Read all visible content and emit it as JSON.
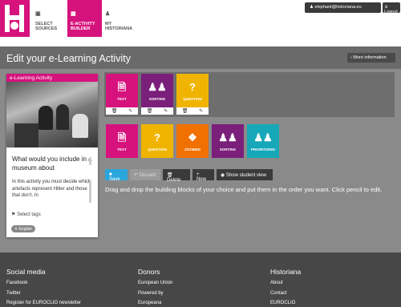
{
  "header": {
    "nav": [
      {
        "label": "SELECT SOURCES",
        "icon": "image-icon"
      },
      {
        "label": "E-ACTIVITY BUILDER",
        "icon": "grid-icon"
      },
      {
        "label": "MY HISTORIANA",
        "icon": "person-icon"
      }
    ],
    "user_email": "elephant@historiana.eu",
    "logout_label": "Logout"
  },
  "page": {
    "title": "Edit your e-Learning Activity",
    "more_info": "More information"
  },
  "activity_card": {
    "header": "e-Learning Activity",
    "question": "What would you include in a museum about",
    "description": "In this activity you must decide which artefacts represent Hitler and those that don't. In",
    "select_tags": "Select tags",
    "language_tag": "English"
  },
  "selected_blocks": [
    {
      "label": "TEXT",
      "color": "#d6127d",
      "icon": "document-icon"
    },
    {
      "label": "SORTING",
      "color": "#7a1f7a",
      "icon": "people-icon"
    },
    {
      "label": "QUESTION",
      "color": "#f0b400",
      "icon": "question-icon"
    }
  ],
  "available_blocks": [
    {
      "label": "TEXT",
      "color": "#d6127d",
      "icon": "document-icon"
    },
    {
      "label": "QUESTION",
      "color": "#f0b400",
      "icon": "question-icon"
    },
    {
      "label": "ZOOMED",
      "color": "#f07000",
      "icon": "zoom-icon"
    },
    {
      "label": "SORTING",
      "color": "#7a1f7a",
      "icon": "people-icon"
    },
    {
      "label": "PRIORITIZING",
      "color": "#16a8b8",
      "icon": "people-icon"
    }
  ],
  "toolbar": {
    "save": "Save",
    "discard": "Discard",
    "delete": "Delete",
    "new": "New",
    "show": "Show student view"
  },
  "instructions": "Drag and drop the building blocks of your choice and put them in the order you want. Click pencil to edit.",
  "footer": {
    "social": {
      "title": "Social media",
      "links": [
        "Facebook",
        "Twitter",
        "Register for EUROCLIO newsletter"
      ]
    },
    "donors": {
      "title": "Donors",
      "links": [
        "European Union",
        "Powered by",
        "Europeana"
      ]
    },
    "historiana": {
      "title": "Historiana",
      "links": [
        "About",
        "Contact",
        "EUROCLIO"
      ]
    }
  }
}
